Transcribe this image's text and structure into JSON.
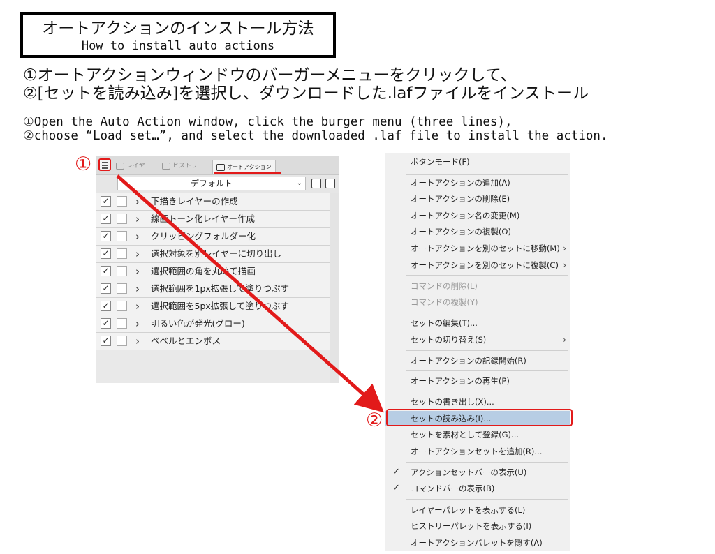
{
  "title": {
    "jp": "オートアクションのインストール方法",
    "en": "How to install auto actions"
  },
  "instructions_jp": [
    "①オートアクションウィンドウのバーガーメニューをクリックして、",
    "②[セットを読み込み]を選択し、ダウンロードした.lafファイルをインストール"
  ],
  "instructions_en": [
    "①Open the Auto Action window, click the burger menu (three lines),",
    "②choose “Load set…”, and select the downloaded .laf file to install the action."
  ],
  "step_markers": {
    "one": "①",
    "two": "②"
  },
  "panel": {
    "tabs": [
      "レイヤー",
      "ヒストリー",
      "オートアクション"
    ],
    "set_name": "デフォルト",
    "items": [
      "下描きレイヤーの作成",
      "線画トーン化レイヤー作成",
      "クリッピングフォルダー化",
      "選択対象を別レイヤーに切り出し",
      "選択範囲の角を丸めて描画",
      "選択範囲を1px拡張して塗りつぶす",
      "選択範囲を5px拡張して塗りつぶす",
      "明るい色が発光(グロー)",
      "ベベルとエンボス"
    ],
    "check_mark": "✓",
    "chevron": "›"
  },
  "menu": {
    "items": [
      {
        "label": "ボタンモード(F)"
      },
      {
        "label": "オートアクションの追加(A)"
      },
      {
        "label": "オートアクションの削除(E)"
      },
      {
        "label": "オートアクション名の変更(M)"
      },
      {
        "label": "オートアクションの複製(O)"
      },
      {
        "label": "オートアクションを別のセットに移動(M)",
        "submenu": "›"
      },
      {
        "label": "オートアクションを別のセットに複製(C)",
        "submenu": "›"
      },
      {
        "label": "コマンドの削除(L)",
        "disabled": true
      },
      {
        "label": "コマンドの複製(Y)",
        "disabled": true
      },
      {
        "label": "セットの編集(T)..."
      },
      {
        "label": "セットの切り替え(S)",
        "submenu": "›"
      },
      {
        "label": "オートアクションの記録開始(R)"
      },
      {
        "label": "オートアクションの再生(P)"
      },
      {
        "label": "セットの書き出し(X)..."
      },
      {
        "label": "セットの読み込み(I)...",
        "highlight": true
      },
      {
        "label": "セットを素材として登録(G)..."
      },
      {
        "label": "オートアクションセットを追加(R)..."
      },
      {
        "label": "アクションセットバーの表示(U)",
        "checked": "✓"
      },
      {
        "label": "コマンドバーの表示(B)",
        "checked": "✓"
      },
      {
        "label": "レイヤーパレットを表示する(L)"
      },
      {
        "label": "ヒストリーパレットを表示する(I)"
      },
      {
        "label": "オートアクションパレットを隠す(A)"
      }
    ]
  },
  "colors": {
    "accent": "#e21a1a",
    "menu_highlight": "#b7cde4"
  }
}
